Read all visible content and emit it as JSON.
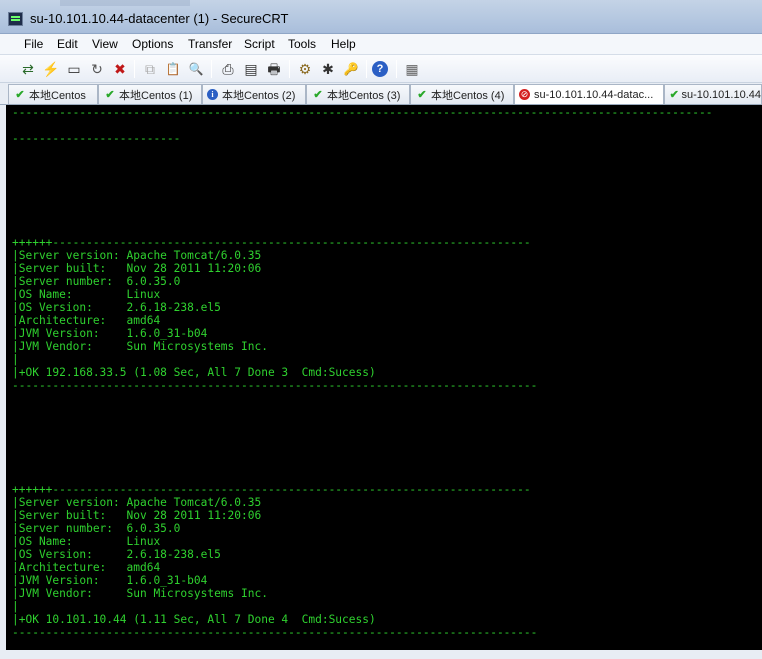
{
  "window": {
    "title": "su-10.101.10.44-datacenter (1) - SecureCRT"
  },
  "menu": [
    "File",
    "Edit",
    "View",
    "Options",
    "Transfer",
    "Script",
    "Tools",
    "Help"
  ],
  "toolbar": {
    "buttons": [
      {
        "name": "connect-icon",
        "glyph": "⇄"
      },
      {
        "name": "quick-connect-icon",
        "glyph": "⚡"
      },
      {
        "name": "connect-in-tab-icon",
        "glyph": "▭"
      },
      {
        "name": "reconnect-icon",
        "glyph": "↻"
      },
      {
        "name": "disconnect-icon",
        "glyph": "✖"
      },
      {
        "name": "copy-icon",
        "glyph": "⧉"
      },
      {
        "name": "paste-icon",
        "glyph": "📋"
      },
      {
        "name": "find-icon",
        "glyph": "🔍"
      },
      {
        "name": "print-setup-icon",
        "glyph": "⎙"
      },
      {
        "name": "print-selection-icon",
        "glyph": "▤"
      },
      {
        "name": "print-icon",
        "glyph": "🖶"
      },
      {
        "name": "session-options-icon",
        "glyph": "⚙"
      },
      {
        "name": "global-options-icon",
        "glyph": "✱"
      },
      {
        "name": "keymap-icon",
        "glyph": "🔑"
      },
      {
        "name": "help-icon",
        "glyph": "?"
      },
      {
        "name": "sftp-icon",
        "glyph": "▦"
      }
    ]
  },
  "tabs": [
    {
      "label": "本地Centos",
      "status": "ok",
      "status_icon": "check-icon",
      "glyph": "✔"
    },
    {
      "label": "本地Centos (1)",
      "status": "ok",
      "status_icon": "check-icon",
      "glyph": "✔"
    },
    {
      "label": "本地Centos (2)",
      "status": "info",
      "status_icon": "info-icon",
      "glyph": "i"
    },
    {
      "label": "本地Centos (3)",
      "status": "ok",
      "status_icon": "check-icon",
      "glyph": "✔"
    },
    {
      "label": "本地Centos (4)",
      "status": "ok",
      "status_icon": "check-icon",
      "glyph": "✔"
    },
    {
      "label": "su-10.101.10.44-datac...",
      "status": "error",
      "status_icon": "error-icon",
      "glyph": "⊘"
    },
    {
      "label": "su-10.101.10.44",
      "status": "ok",
      "status_icon": "check-icon",
      "glyph": "✔"
    }
  ],
  "terminal": {
    "text": "--------------------------------------------------------------------------------------------------------\n\n-------------------------\n\n\n\n\n\n\n\n++++++-----------------------------------------------------------------------\n|Server version: Apache Tomcat/6.0.35\n|Server built:   Nov 28 2011 11:20:06\n|Server number:  6.0.35.0\n|OS Name:        Linux\n|OS Version:     2.6.18-238.el5\n|Architecture:   amd64\n|JVM Version:    1.6.0_31-b04\n|JVM Vendor:     Sun Microsystems Inc.\n|\n|+OK 192.168.33.5 (1.08 Sec, All 7 Done 3  Cmd:Sucess)\n------------------------------------------------------------------------------\n\n\n\n\n\n\n\n++++++-----------------------------------------------------------------------\n|Server version: Apache Tomcat/6.0.35\n|Server built:   Nov 28 2011 11:20:06\n|Server number:  6.0.35.0\n|OS Name:        Linux\n|OS Version:     2.6.18-238.el5\n|Architecture:   amd64\n|JVM Version:    1.6.0_31-b04\n|JVM Vendor:     Sun Microsystems Inc.\n|\n|+OK 10.101.10.44 (1.11 Sec, All 7 Done 4  Cmd:Sucess)\n------------------------------------------------------------------------------",
    "foreground": "#2fd12f",
    "background": "#000000"
  }
}
